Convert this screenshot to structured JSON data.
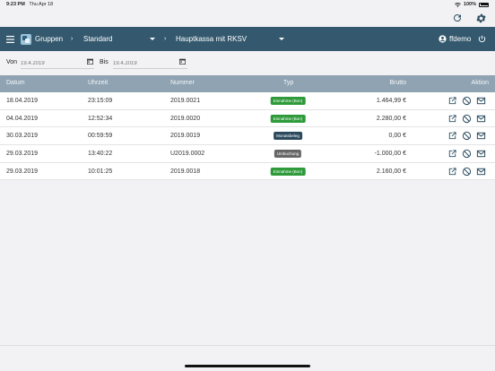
{
  "status": {
    "time": "9:23 PM",
    "date": "Thu Apr 18",
    "battery": "100%"
  },
  "nav": {
    "groups": "Gruppen",
    "filter": "Standard",
    "register": "Hauptkassa mit RKSV",
    "user": "ffdemo"
  },
  "filters": {
    "from_label": "Von",
    "from_value": "19.4.2019",
    "to_label": "Bis",
    "to_value": "19.4.2019"
  },
  "table": {
    "headers": {
      "date": "Datum",
      "time": "Uhrzeit",
      "number": "Nummer",
      "type": "Typ",
      "gross": "Brutto",
      "action": "Aktion"
    },
    "rows": [
      {
        "date": "18.04.2019",
        "time": "23:15:09",
        "number": "2019.0021",
        "type": "Einnahme (Bon)",
        "type_color": "green",
        "gross": "1.464,99 €"
      },
      {
        "date": "04.04.2019",
        "time": "12:52:34",
        "number": "2019.0020",
        "type": "Einnahme (Bon)",
        "type_color": "green",
        "gross": "2.280,00 €"
      },
      {
        "date": "30.03.2019",
        "time": "00:59:59",
        "number": "2019.0019",
        "type": "Monatsbeleg",
        "type_color": "navy",
        "gross": "0,00 €"
      },
      {
        "date": "29.03.2019",
        "time": "13:40:22",
        "number": "U2019.0002",
        "type": "Umbuchung",
        "type_color": "gray",
        "gross": "-1.000,00 €"
      },
      {
        "date": "29.03.2019",
        "time": "10:01:25",
        "number": "2019.0018",
        "type": "Einnahme (Bon)",
        "type_color": "green",
        "gross": "2.160,00 €"
      }
    ]
  },
  "colors": {
    "navbar": "#34596e",
    "header": "#8fa3b2",
    "green": "#2e9a3a",
    "navy": "#2c4a5d",
    "gray": "#666666",
    "icon": "#2f4f63"
  }
}
